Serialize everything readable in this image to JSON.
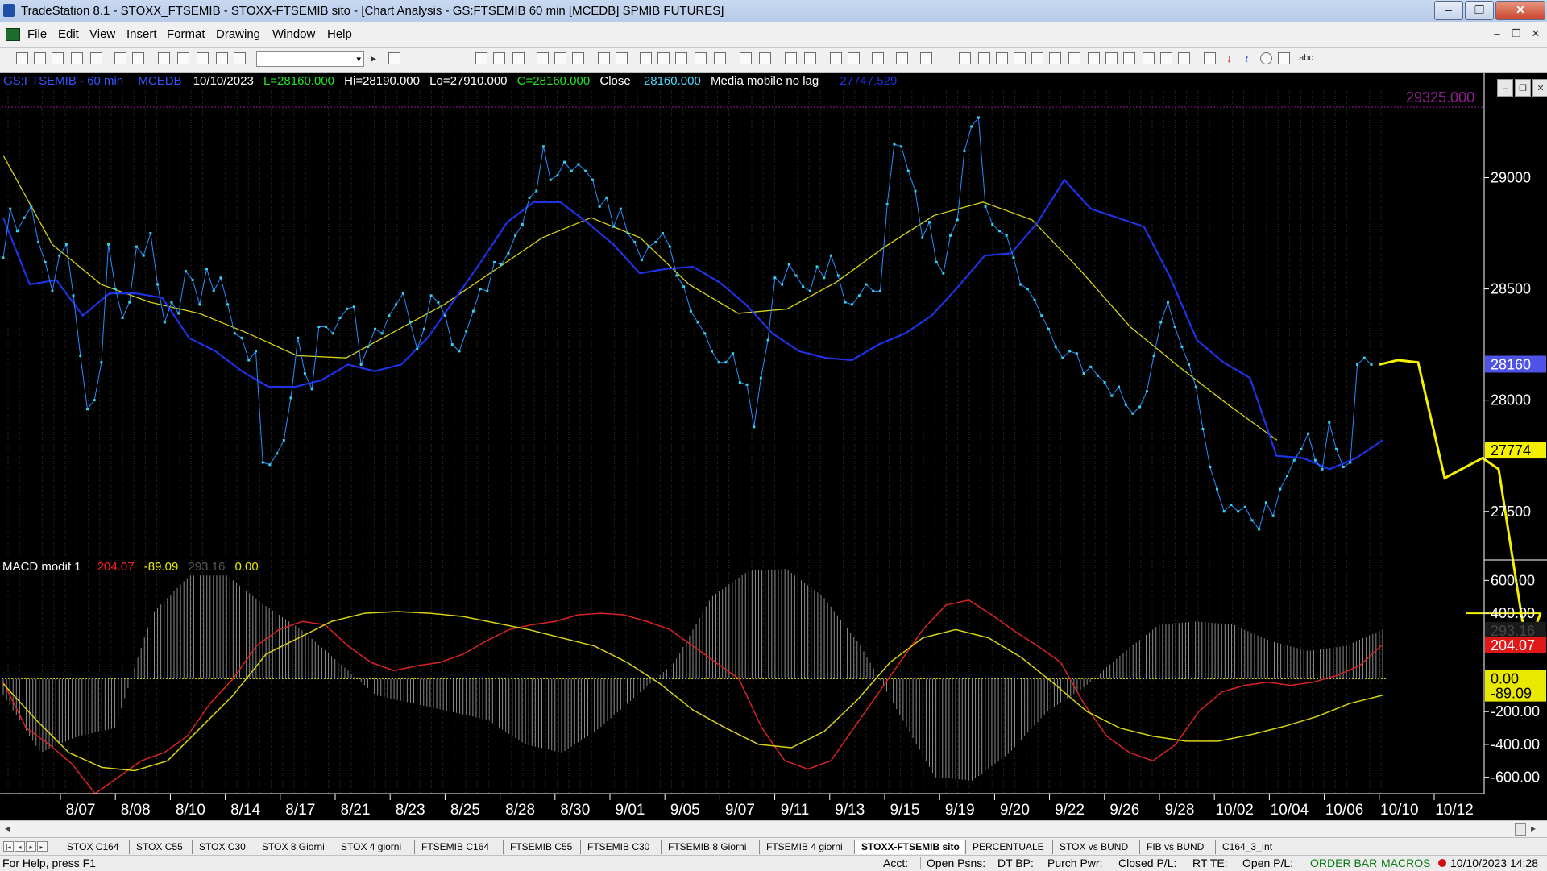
{
  "window": {
    "title": "TradeStation 8.1 - STOXX_FTSEMIB - STOXX-FTSEMIB sito - [Chart Analysis - GS:FTSEMIB  60 min  [MCEDB] SPMIB FUTURES]",
    "minimize": "–",
    "restore": "❐",
    "close": "✕"
  },
  "menu": {
    "items": [
      "File",
      "Edit",
      "View",
      "Insert",
      "Format",
      "Drawing",
      "Window",
      "Help"
    ],
    "mdi_minimize": "–",
    "mdi_restore": "❐",
    "mdi_close": "✕"
  },
  "toolbar": {
    "combo_value": "",
    "combo_arrow": "▾",
    "play_arrow": "▸",
    "text_tool": "abc"
  },
  "chart_header": {
    "symbol": "GS:FTSEMIB - 60 min",
    "feed": "MCEDB",
    "date": "10/10/2023",
    "last": "L=28160.000",
    "high": "Hi=28190.000",
    "low": "Lo=27910.000",
    "close_eq": "C=28160.000",
    "close_label": "Close",
    "close_value": "28160.000",
    "ma_label": "Media mobile no lag",
    "ma_value": "27747.529"
  },
  "macd_header": {
    "label": "MACD modif 1",
    "v1": "204.07",
    "v2": "-89.09",
    "v3": "293.16",
    "v4": "0.00"
  },
  "chart_data": [
    {
      "type": "line",
      "panel": "price",
      "ylim": [
        27300,
        29400
      ],
      "y_ticks": [
        "29000",
        "28500",
        "28000",
        "27500"
      ],
      "y_tick_values": [
        29000,
        28500,
        28000,
        27500
      ],
      "x_ticks": [
        "8/07",
        "8/08",
        "8/10",
        "8/14",
        "8/17",
        "8/21",
        "8/23",
        "8/25",
        "8/28",
        "8/30",
        "9/01",
        "9/05",
        "9/07",
        "9/11",
        "9/13",
        "9/15",
        "9/19",
        "9/20",
        "9/22",
        "9/26",
        "9/28",
        "10/02",
        "10/04",
        "10/06",
        "10/10",
        "10/12"
      ],
      "price_axis_labels": {
        "top_ref": "29325.000",
        "last": "28160",
        "ma": "27774"
      },
      "series": [
        {
          "name": "Close",
          "color": "#35d4ee",
          "values": [
            28640,
            28860,
            28760,
            28820,
            28870,
            28710,
            28620,
            28490,
            28650,
            28700,
            28470,
            28200,
            27960,
            28000,
            28170,
            28700,
            28500,
            28370,
            28440,
            28690,
            28650,
            28750,
            28520,
            28350,
            28440,
            28390,
            28580,
            28540,
            28430,
            28590,
            28490,
            28550,
            28430,
            28300,
            28280,
            28180,
            28220,
            27720,
            27710,
            27760,
            27820,
            28010,
            28280,
            28120,
            28050,
            28330,
            28330,
            28300,
            28370,
            28410,
            28420,
            28160,
            28240,
            28320,
            28300,
            28380,
            28430,
            28480,
            28350,
            28230,
            28320,
            28470,
            28440,
            28380,
            28250,
            28220,
            28310,
            28400,
            28500,
            28490,
            28620,
            28610,
            28660,
            28740,
            28790,
            28910,
            28940,
            29140,
            28990,
            29010,
            29070,
            29030,
            29060,
            29030,
            28990,
            28870,
            28910,
            28780,
            28860,
            28750,
            28710,
            28630,
            28690,
            28710,
            28750,
            28690,
            28560,
            28510,
            28400,
            28350,
            28300,
            28220,
            28170,
            28170,
            28210,
            28080,
            28070,
            27880,
            28100,
            28270,
            28550,
            28520,
            28610,
            28560,
            28510,
            28490,
            28600,
            28550,
            28650,
            28560,
            28440,
            28430,
            28470,
            28520,
            28490,
            28490,
            28880,
            29150,
            29140,
            29030,
            28940,
            28730,
            28800,
            28620,
            28570,
            28740,
            28810,
            29120,
            29230,
            29270,
            28870,
            28790,
            28760,
            28740,
            28640,
            28520,
            28500,
            28450,
            28380,
            28320,
            28240,
            28190,
            28220,
            28210,
            28120,
            28150,
            28110,
            28080,
            28020,
            28060,
            27980,
            27940,
            27970,
            28040,
            28200,
            28350,
            28440,
            28330,
            28240,
            28160,
            28060,
            27870,
            27700,
            27600,
            27500,
            27530,
            27500,
            27520,
            27460,
            27420,
            27540,
            27480,
            27600,
            27660,
            27730,
            27780,
            27850,
            27730,
            27690,
            27900,
            27780,
            27700,
            27720,
            28160,
            28190,
            28160
          ]
        },
        {
          "name": "Media mobile no lag",
          "color": "#1e32e6",
          "values": [
            28820,
            28520,
            28540,
            28380,
            28480,
            28480,
            28460,
            28280,
            28220,
            28130,
            28060,
            28060,
            28090,
            28160,
            28130,
            28160,
            28280,
            28450,
            28620,
            28800,
            28890,
            28890,
            28800,
            28700,
            28570,
            28590,
            28600,
            28530,
            28430,
            28300,
            28220,
            28190,
            28180,
            28250,
            28300,
            28380,
            28510,
            28650,
            28660,
            28800,
            28990,
            28860,
            28820,
            28780,
            28550,
            28270,
            28170,
            28100,
            27750,
            27740,
            27690,
            27740,
            27820
          ]
        },
        {
          "name": "Moving Average",
          "color": "#d6d316",
          "values": [
            29100,
            28700,
            28520,
            28440,
            28390,
            28300,
            28200,
            28190,
            28310,
            28430,
            28580,
            28730,
            28820,
            28730,
            28520,
            28390,
            28410,
            28530,
            28690,
            28830,
            28890,
            28810,
            28580,
            28330,
            28150,
            27980,
            27820
          ]
        },
        {
          "name": "Projection",
          "color": "#f4f000",
          "values": [
            28160,
            28180,
            28170,
            27650,
            27740,
            27690,
            26900,
            26400
          ]
        }
      ]
    },
    {
      "type": "line",
      "panel": "macd",
      "ylim": [
        -700,
        700
      ],
      "y_ticks": [
        "600.00",
        "400.00",
        "293.16",
        "204.07",
        "0.00",
        "-89.09",
        "-200.00",
        "-400.00",
        "-600.00"
      ],
      "y_tick_values": [
        600,
        400,
        293.16,
        204.07,
        0,
        -89.09,
        -200,
        -400,
        -600
      ],
      "series": [
        {
          "name": "MACD",
          "color": "#d92323",
          "values": [
            -20,
            -300,
            -400,
            -520,
            -700,
            -600,
            -500,
            -450,
            -350,
            -150,
            0,
            200,
            300,
            350,
            330,
            200,
            100,
            50,
            80,
            100,
            150,
            230,
            300,
            330,
            350,
            390,
            400,
            390,
            350,
            300,
            200,
            100,
            0,
            -300,
            -500,
            -550,
            -500,
            -300,
            -100,
            100,
            300,
            450,
            480,
            390,
            290,
            200,
            100,
            -150,
            -350,
            -450,
            -500,
            -400,
            -200,
            -80,
            -40,
            -20,
            -40,
            -20,
            20,
            80,
            210
          ]
        },
        {
          "name": "Signal",
          "color": "#d6d316",
          "values": [
            -30,
            -250,
            -450,
            -540,
            -560,
            -500,
            -300,
            -100,
            150,
            250,
            350,
            400,
            410,
            400,
            380,
            340,
            300,
            250,
            200,
            100,
            -30,
            -190,
            -300,
            -400,
            -420,
            -320,
            -130,
            100,
            250,
            300,
            250,
            130,
            -30,
            -200,
            -300,
            -350,
            -380,
            -380,
            -340,
            -290,
            -230,
            -150,
            -100
          ]
        },
        {
          "name": "Histogram",
          "color": "#8c8c8c",
          "values": [
            -100,
            -450,
            -350,
            -300,
            400,
            630,
            630,
            450,
            300,
            100,
            -100,
            -150,
            -200,
            -250,
            -400,
            -450,
            -300,
            -100,
            100,
            500,
            660,
            670,
            500,
            200,
            -200,
            -600,
            -620,
            -450,
            -200,
            -50,
            150,
            330,
            350,
            330,
            230,
            170,
            200,
            300
          ]
        }
      ]
    }
  ],
  "scroll": {
    "left": "◂",
    "right": "▸"
  },
  "tabs": {
    "nav": [
      "|◂",
      "◂",
      "▸",
      "▸|"
    ],
    "items": [
      "STOX C164",
      "STOX C55",
      "STOX  C30",
      "STOX  8 Giorni",
      "STOX 4 giorni",
      "FTSEMIB C164",
      "FTSEMIB C55",
      "FTSEMIB C30",
      "FTSEMIB  8 Giorni",
      "FTSEMIB  4 giorni",
      "STOXX-FTSEMIB sito",
      "PERCENTUALE",
      "STOX vs BUND",
      "FIB vs BUND",
      "C164_3_Int"
    ],
    "active_index": 10
  },
  "status": {
    "help": "For Help, press F1",
    "acct": "Acct:",
    "open_psns": "Open Psns:",
    "dt_bp": "DT BP:",
    "purch_pwr": "Purch Pwr:",
    "closed_pl": "Closed P/L:",
    "rt_te": "RT TE:",
    "open_pl": "Open P/L:",
    "order_bar": "ORDER BAR",
    "macros": "MACROS",
    "datetime": "10/10/2023 14:28"
  },
  "colors": {
    "price_line": "#35d4ee",
    "ma_blue": "#1e32e6",
    "ma_yellow": "#d6d316",
    "projection": "#f4f000",
    "macd_red": "#d92323",
    "macd_hist": "#8c8c8c",
    "header_green": "#22e222",
    "header_blue": "#3355ff",
    "header_cyan": "#4ad8ff",
    "top_ref": "#8f1f8f",
    "last_box": "#4f52e6",
    "ma_box": "#f4f000"
  }
}
